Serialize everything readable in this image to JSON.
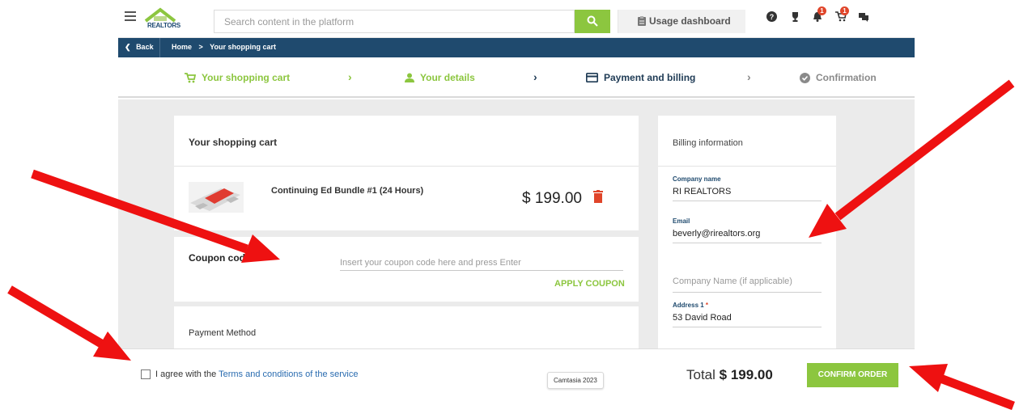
{
  "header": {
    "logo_text": "REALTORS",
    "search_placeholder": "Search content in the platform",
    "usage_label": "Usage dashboard",
    "notif_count": "1",
    "cart_count": "1"
  },
  "breadcrumb": {
    "back_label": "Back",
    "items": [
      "Home",
      ">",
      "Your shopping cart"
    ]
  },
  "steps": [
    {
      "label": "Your shopping cart"
    },
    {
      "label": "Your details"
    },
    {
      "label": "Payment and billing"
    },
    {
      "label": "Confirmation"
    }
  ],
  "cart": {
    "title": "Your shopping cart",
    "item_name": "Continuing Ed Bundle #1 (24 Hours)",
    "price": "$ 199.00"
  },
  "coupon": {
    "label": "Coupon code",
    "placeholder": "Insert your coupon code here and press Enter",
    "apply_label": "APPLY COUPON"
  },
  "payment": {
    "label": "Payment Method"
  },
  "billing": {
    "title": "Billing information",
    "company_label": "Company name",
    "company_value": "RI REALTORS",
    "email_label": "Email",
    "email_value": "beverly@rirealtors.org",
    "company2_placeholder": "Company Name (if applicable)",
    "address_label": "Address 1",
    "address_required": "*",
    "address_value": "53 David Road"
  },
  "footer": {
    "agree_prefix": "I agree with the",
    "terms_link": "Terms and conditions of the service",
    "tooltip": "Camtasia 2023",
    "total_label": "Total",
    "total_value": "$ 199.00",
    "confirm_label": "CONFIRM ORDER"
  },
  "colors": {
    "accent_green": "#8cc63f",
    "navy": "#1f4a6e",
    "badge_red": "#e0452a",
    "annotation_red": "#ee1111"
  }
}
